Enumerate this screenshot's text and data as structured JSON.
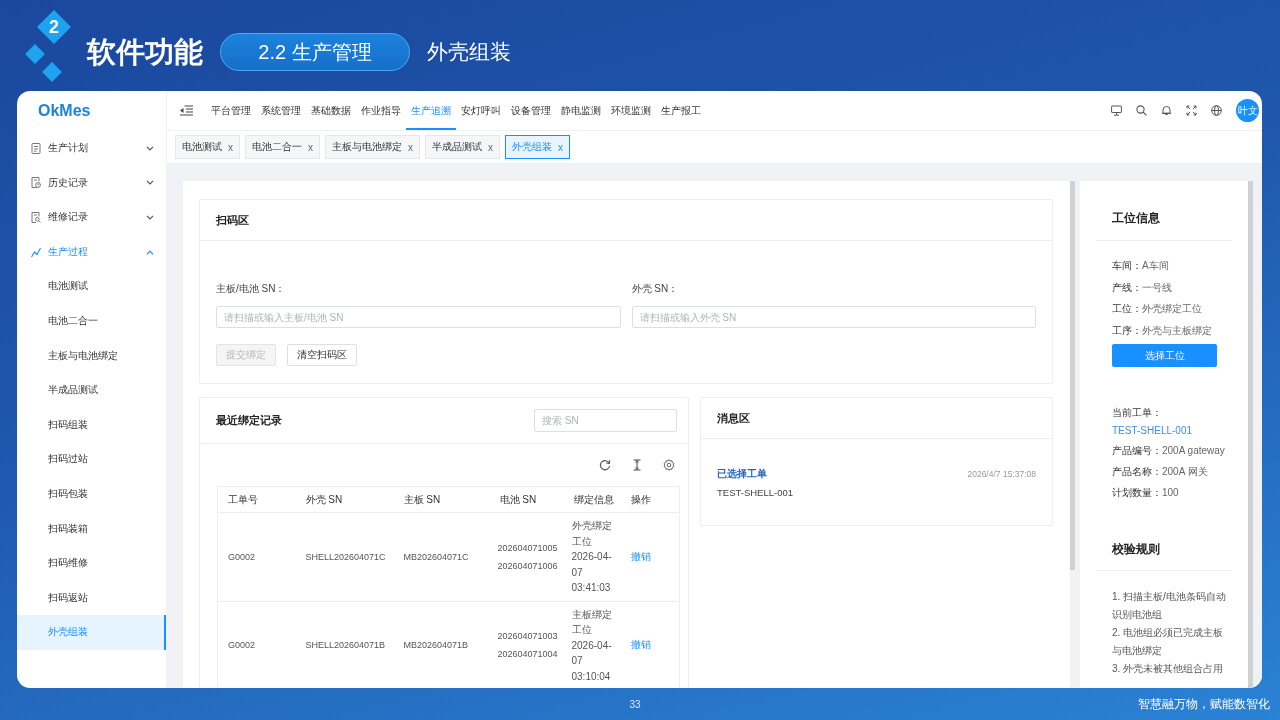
{
  "header": {
    "section_number": "2",
    "title": "软件功能",
    "section_pill": "2.2 生产管理",
    "subtitle": "外壳组装"
  },
  "app": {
    "logo": "OkMes",
    "top_menu": [
      {
        "label": "平台管理",
        "selected": false
      },
      {
        "label": "系统管理",
        "selected": false
      },
      {
        "label": "基础数据",
        "selected": false
      },
      {
        "label": "作业指导",
        "selected": false
      },
      {
        "label": "生产追溯",
        "selected": true
      },
      {
        "label": "安灯呼叫",
        "selected": false
      },
      {
        "label": "设备管理",
        "selected": false
      },
      {
        "label": "静电监测",
        "selected": false
      },
      {
        "label": "环境监测",
        "selected": false
      },
      {
        "label": "生产报工",
        "selected": false
      }
    ],
    "user_avatar": "叶文",
    "sidebar": [
      {
        "label": "生产计划",
        "selected": false,
        "expanded": false
      },
      {
        "label": "历史记录",
        "selected": false,
        "expanded": false
      },
      {
        "label": "维修记录",
        "selected": false,
        "expanded": false
      },
      {
        "label": "生产过程",
        "selected": true,
        "expanded": true,
        "children": [
          {
            "label": "电池测试",
            "selected": false
          },
          {
            "label": "电池二合一",
            "selected": false
          },
          {
            "label": "主板与电池绑定",
            "selected": false
          },
          {
            "label": "半成品测试",
            "selected": false
          },
          {
            "label": "扫码组装",
            "selected": false
          },
          {
            "label": "扫码过站",
            "selected": false
          },
          {
            "label": "扫码包装",
            "selected": false
          },
          {
            "label": "扫码装箱",
            "selected": false
          },
          {
            "label": "扫码维修",
            "selected": false
          },
          {
            "label": "扫码返站",
            "selected": false
          },
          {
            "label": "外壳组装",
            "selected": true
          }
        ]
      }
    ],
    "tabs": [
      {
        "label": "电池测试",
        "close": "x",
        "selected": false
      },
      {
        "label": "电池二合一",
        "close": "x",
        "selected": false
      },
      {
        "label": "主板与电池绑定",
        "close": "x",
        "selected": false
      },
      {
        "label": "半成品测试",
        "close": "x",
        "selected": false
      },
      {
        "label": "外壳组装",
        "close": "x",
        "selected": true
      }
    ],
    "scan_area": {
      "title": "扫码区",
      "fields": [
        {
          "label": "主板/电池 SN：",
          "placeholder": "请扫描或输入主板/电池 SN"
        },
        {
          "label": "外壳 SN：",
          "placeholder": "请扫描或输入外壳 SN"
        }
      ],
      "buttons": [
        {
          "label": "提交绑定",
          "disabled": true
        },
        {
          "label": "清空扫码区",
          "disabled": false
        }
      ]
    },
    "recent_bindings": {
      "title": "最近绑定记录",
      "search": {
        "placeholder": "搜索 SN"
      },
      "table": {
        "columns": [
          "工单号",
          "外壳 SN",
          "主板 SN",
          "电池 SN",
          "绑定信息",
          "操作"
        ],
        "rows": [
          {
            "order_no": "G0002",
            "shell_sn": "SHELL202604071C",
            "board_sn": "MB202604071C",
            "battery_sn": [
              "202604071005",
              "202604071006"
            ],
            "binding_info": "外壳绑定工位 2026-04-07 03:41:03",
            "action": "撤销"
          },
          {
            "order_no": "G0002",
            "shell_sn": "SHELL202604071B",
            "board_sn": "MB202604071B",
            "battery_sn": [
              "202604071003",
              "202604071004"
            ],
            "binding_info": "主板绑定工位 2026-04-07 03:10:04",
            "action": "撤销"
          }
        ]
      }
    },
    "messages": {
      "title": "消息区",
      "items": [
        {
          "title": "已选择工单",
          "time": "2026/4/7 15:37:08",
          "body": "TEST-SHELL-001"
        }
      ]
    },
    "station_info": {
      "title": "工位信息",
      "fields": [
        {
          "label": "车间：",
          "value": "A车间"
        },
        {
          "label": "产线：",
          "value": "一号线"
        },
        {
          "label": "工位：",
          "value": "外壳绑定工位"
        },
        {
          "label": "工序：",
          "value": "外壳与主板绑定"
        }
      ],
      "button": "选择工位"
    },
    "work_order": {
      "label": "当前工单：",
      "value": "TEST-SHELL-001",
      "fields": [
        {
          "label": "产品编号：",
          "value": "200A gateway"
        },
        {
          "label": "产品名称：",
          "value": "200A 网关"
        },
        {
          "label": "计划数量：",
          "value": "100"
        }
      ]
    },
    "rules": {
      "title": "校验规则",
      "items": [
        "1. 扫描主板/电池条码自动识别电池组",
        "2. 电池组必须已完成主板与电池绑定",
        "3. 外壳未被其他组合占用"
      ]
    }
  },
  "footer": {
    "page_number": "33",
    "slogan": "智慧融万物，赋能数智化"
  }
}
